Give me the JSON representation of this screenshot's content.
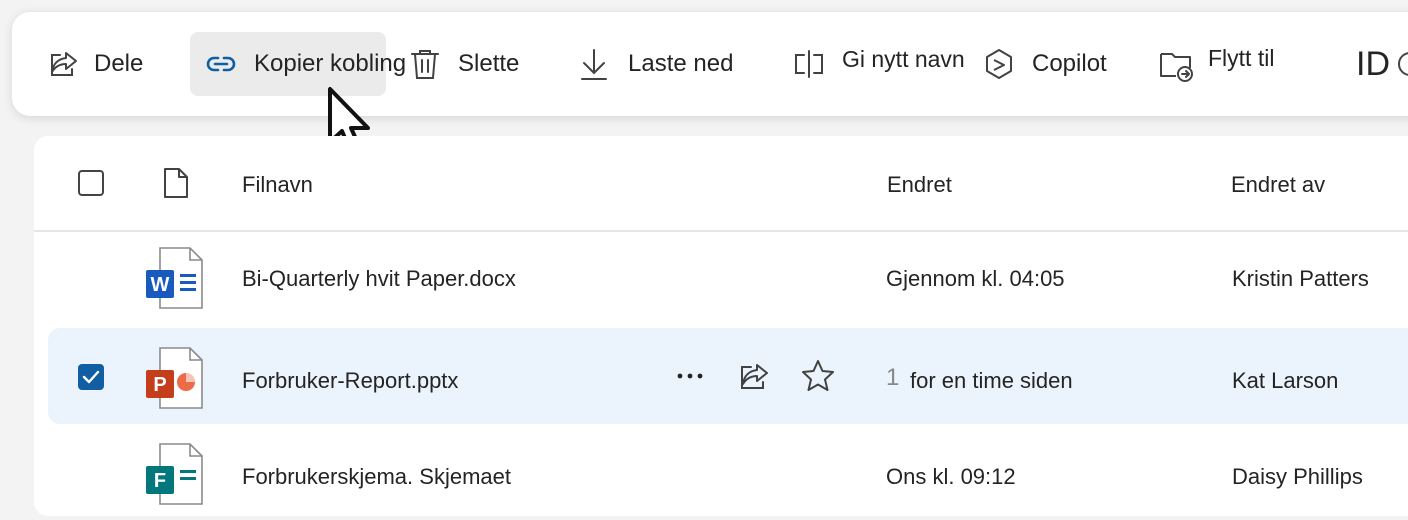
{
  "toolbar": {
    "items": [
      {
        "label": "Dele",
        "icon": "share-icon"
      },
      {
        "label": "Kopier kobling",
        "icon": "link-icon"
      },
      {
        "label": "Slette",
        "icon": "trash-icon"
      },
      {
        "label": "Laste ned",
        "icon": "download-icon"
      },
      {
        "label": "Gi nytt navn",
        "icon": "rename-icon"
      },
      {
        "label": "Copilot",
        "icon": "copilot-icon"
      },
      {
        "label": "Flytt til",
        "icon": "move-folder-icon"
      },
      {
        "label": "ID",
        "icon": "id-icon"
      }
    ]
  },
  "table": {
    "columns": {
      "name": "Filnavn",
      "modified": "Endret",
      "modified_by": "Endret av"
    },
    "rows": [
      {
        "name": "Bi-Quarterly hvit Paper.docx",
        "modified": "Gjennom kl. 04:05",
        "modified_by": "Kristin   Patters",
        "type": "word",
        "selected": false
      },
      {
        "name": "Forbruker-Report.pptx",
        "modified": "for en time siden",
        "modified_prefix": "1",
        "modified_by": "Kat Larson",
        "type": "powerpoint",
        "selected": true
      },
      {
        "name": "Forbrukerskjema. Skjemaet",
        "modified": "Ons kl. 09:12",
        "modified_by": "Daisy Phillips",
        "type": "forms",
        "selected": false
      }
    ]
  },
  "colors": {
    "accent": "#115ea3",
    "selected_row": "#ebf3fc",
    "word": "#185abd",
    "powerpoint": "#c43e1c",
    "forms": "#03787c"
  }
}
